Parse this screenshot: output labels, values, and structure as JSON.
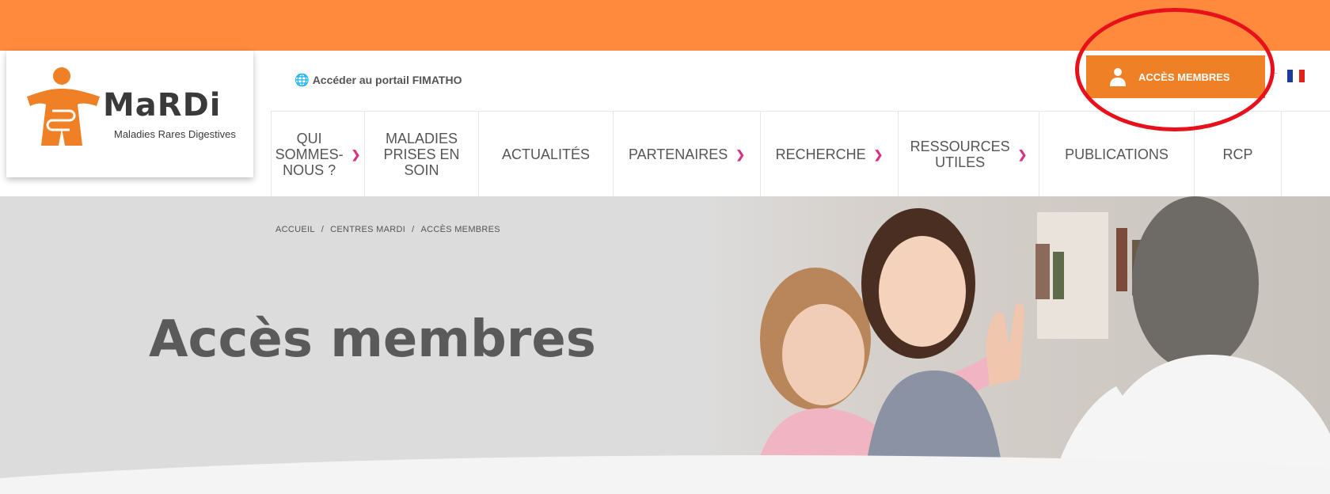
{
  "logo": {
    "name": "MaRDi",
    "subtitle": "Maladies Rares Digestives"
  },
  "utility": {
    "portal_link": "Accéder au portail FIMATHO",
    "members_button": "ACCÈS MEMBRES"
  },
  "nav": {
    "items": [
      {
        "label": "QUI\nSOMMES-\nNOUS ?",
        "dropdown": true
      },
      {
        "label": "MALADIES\nPRISES EN\nSOIN",
        "dropdown": false
      },
      {
        "label": "ACTUALITÉS",
        "dropdown": false
      },
      {
        "label": "PARTENAIRES",
        "dropdown": true
      },
      {
        "label": "RECHERCHE",
        "dropdown": true
      },
      {
        "label": "RESSOURCES\nUTILES",
        "dropdown": true
      },
      {
        "label": "PUBLICATIONS",
        "dropdown": false
      },
      {
        "label": "RCP",
        "dropdown": false
      }
    ]
  },
  "breadcrumb": {
    "items": [
      "ACCUEIL",
      "CENTRES MARDI",
      "ACCÈS MEMBRES"
    ],
    "separator": "/"
  },
  "hero": {
    "title": "Accès membres"
  },
  "colors": {
    "orange_band": "#ff8a3d",
    "members_button": "#f08026",
    "chevron": "#d63384",
    "highlight": "#e8101a"
  }
}
